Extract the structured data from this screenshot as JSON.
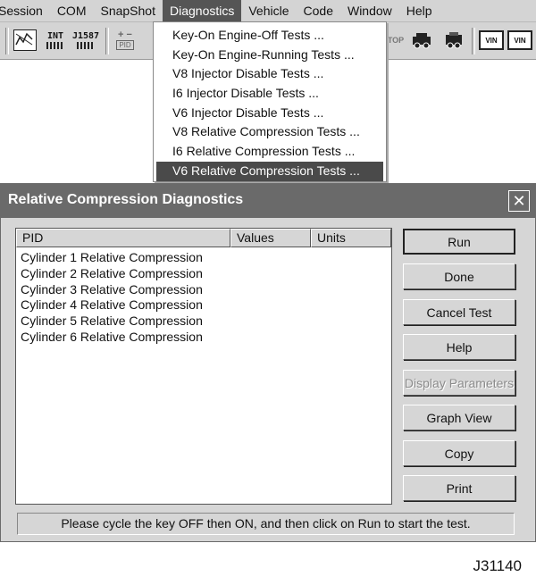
{
  "menubar": {
    "items": [
      "Session",
      "COM",
      "SnapShot",
      "Diagnostics",
      "Vehicle",
      "Code",
      "Window",
      "Help"
    ],
    "active_index": 3
  },
  "toolbar": {
    "int_label": "INT",
    "j1587_label": "J1587",
    "pid_label": "PID",
    "stop_label": "STOP",
    "vin_label": "VIN"
  },
  "diagnostics_menu": {
    "items": [
      "Key-On Engine-Off Tests ...",
      "Key-On Engine-Running Tests ...",
      "V8 Injector Disable Tests ...",
      "I6 Injector Disable Tests ...",
      "V6 Injector Disable Tests ...",
      "V8 Relative Compression Tests ...",
      "I6 Relative Compression Tests ...",
      "V6 Relative Compression Tests ..."
    ],
    "selected_index": 7
  },
  "dialog": {
    "title": "Relative Compression Diagnostics",
    "close_glyph": "✕",
    "columns": [
      "PID",
      "Values",
      "Units"
    ],
    "rows": [
      "Cylinder 1 Relative Compression",
      "Cylinder 2 Relative Compression",
      "Cylinder 3 Relative Compression",
      "Cylinder 4 Relative Compression",
      "Cylinder 5 Relative Compression",
      "Cylinder 6 Relative Compression"
    ],
    "buttons": {
      "run": "Run",
      "done": "Done",
      "cancel_test": "Cancel Test",
      "help": "Help",
      "display_parameters": "Display Parameters",
      "graph_view": "Graph View",
      "copy": "Copy",
      "print": "Print"
    },
    "status": "Please cycle the key OFF then ON, and then click on Run to start the test."
  },
  "figure_code": "J31140"
}
